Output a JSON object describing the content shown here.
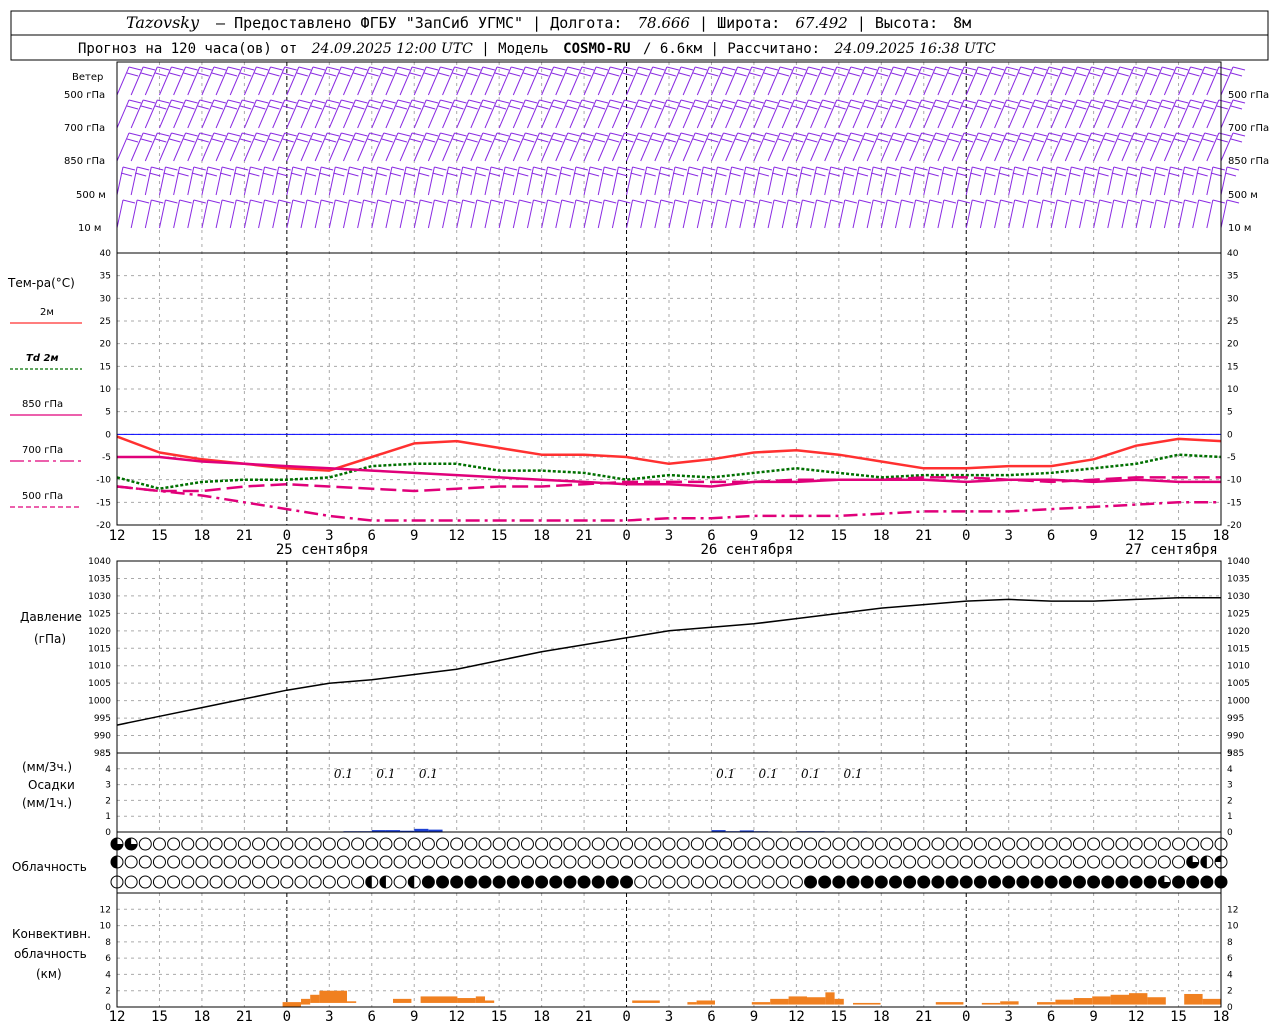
{
  "header": {
    "station": "Tazovsky",
    "provider": "– Предоставлено ФГБУ \"ЗапСиб УГМС\"",
    "lon_label": "Долгота:",
    "lon_value": "78.666",
    "lat_label": "Широта:",
    "lat_value": "67.492",
    "alt_label": "Высота:",
    "alt_value": "8м",
    "forecast_prefix": "Прогноз на 120 часа(ов) от",
    "forecast_time": "24.09.2025 12:00 UTC",
    "model_label": "Модель",
    "model_name": "COSMO-RU",
    "model_res": "/ 6.6км",
    "calc_label": "Рассчитано:",
    "calc_time": "24.09.2025 16:38 UTC"
  },
  "labels": {
    "wind_title": "Ветер",
    "wind_levels": [
      "500 гПа",
      "700 гПа",
      "850 гПа",
      "500 м",
      "10  м"
    ],
    "temp_title": "Тем-ра(°С)",
    "temp_legend": [
      "2м",
      "Td  2м",
      "850 гПа",
      "700 гПа",
      "500 гПа"
    ],
    "pressure_title": "Давление",
    "pressure_unit": "(гПа)",
    "precip_unit_3h": "(мм/3ч.)",
    "precip_title": "Осадки",
    "precip_unit_1h": "(мм/1ч.)",
    "cloud_title": "Облачность",
    "conv_title_1": "Конвективн.",
    "conv_title_2": "облачность",
    "conv_unit": "(км)",
    "day_labels": [
      "25 сентября",
      "26 сентября",
      "27 сентября"
    ],
    "hour_labels": [
      "12",
      "15",
      "18",
      "21",
      "0",
      "3",
      "6",
      "9",
      "12",
      "15",
      "18",
      "21",
      "0",
      "3",
      "6",
      "9",
      "12",
      "15",
      "18",
      "21",
      "0",
      "3",
      "6",
      "9",
      "12",
      "15",
      "18"
    ]
  },
  "colors": {
    "wind": "#8a2be2",
    "t2m": "#ff3030",
    "td2m": "#007000",
    "t850": "#e0007a",
    "t700": "#e0007a",
    "t500": "#e0007a",
    "pressure": "#000000",
    "precip": "#1c3fd4",
    "conv": "#f08020",
    "zero": "#0000ff",
    "grid": "#999999"
  },
  "chart_data": [
    {
      "type": "wind-barbs",
      "levels": [
        "500 гПа",
        "700 гПа",
        "850 гПа",
        "500 м",
        "10  м"
      ],
      "x_hours": [
        0,
        3,
        6,
        9,
        12,
        15,
        18,
        21,
        24,
        27,
        30,
        33,
        36,
        39,
        42,
        45,
        48,
        51,
        54,
        57,
        60,
        63,
        66,
        69,
        72,
        75,
        78
      ],
      "barbs_per_hour": 1
    },
    {
      "type": "line",
      "title": "Тем-ра(°С)",
      "x_hours": [
        0,
        3,
        6,
        9,
        12,
        15,
        18,
        21,
        24,
        27,
        30,
        33,
        36,
        39,
        42,
        45,
        48,
        51,
        54,
        57,
        60,
        63,
        66,
        69,
        72,
        75,
        78
      ],
      "ylim": [
        -20,
        40
      ],
      "yticks": [
        -20,
        -15,
        -10,
        -5,
        0,
        5,
        10,
        15,
        20,
        25,
        30,
        35,
        40
      ],
      "series": [
        {
          "name": "2м",
          "values": [
            -0.5,
            -4,
            -5.5,
            -6.5,
            -7.5,
            -8,
            -5,
            -2,
            -1.5,
            -3,
            -4.5,
            -4.5,
            -5,
            -6.5,
            -5.5,
            -4,
            -3.5,
            -4.5,
            -6,
            -7.5,
            -7.5,
            -7,
            -7,
            -5.5,
            -2.5,
            -1,
            -1.5
          ]
        },
        {
          "name": "Td  2м",
          "values": [
            -9.5,
            -12,
            -10.5,
            -10,
            -10,
            -9.5,
            -7,
            -6.5,
            -6.5,
            -8,
            -8,
            -8.5,
            -10,
            -9,
            -9.5,
            -8.5,
            -7.5,
            -8.5,
            -9.5,
            -9,
            -9,
            -9,
            -8.5,
            -7.5,
            -6.5,
            -4.5,
            -5
          ]
        },
        {
          "name": "850 гПа",
          "values": [
            -11.5,
            -12.5,
            -12.5,
            -11.5,
            -11,
            -11.5,
            -12,
            -12.5,
            -12,
            -11.5,
            -11.5,
            -11,
            -10.5,
            -10.5,
            -10.5,
            -10.5,
            -10,
            -10,
            -10,
            -9.5,
            -9.5,
            -10,
            -10.5,
            -10,
            -9.5,
            -9.5,
            -9.5
          ]
        },
        {
          "name": "700 гПа",
          "values": [
            -5,
            -5,
            -6,
            -6.5,
            -7,
            -7.5,
            -8,
            -8.5,
            -9,
            -9.5,
            -10,
            -10.5,
            -11,
            -11,
            -11.5,
            -10.5,
            -10.5,
            -10,
            -10,
            -10,
            -10.5,
            -10,
            -10,
            -10.5,
            -10,
            -10.5,
            -10.5
          ]
        },
        {
          "name": "500 гПа",
          "values": [
            -11.5,
            -12.5,
            -13.5,
            -15,
            -16.5,
            -18,
            -19,
            -19,
            -19,
            -19,
            -19,
            -19,
            -19,
            -18.5,
            -18.5,
            -18,
            -18,
            -18,
            -17.5,
            -17,
            -17,
            -17,
            -16.5,
            -16,
            -15.5,
            -15,
            -15
          ]
        }
      ]
    },
    {
      "type": "line",
      "title": "Давление",
      "ylabel": "(гПа)",
      "x_hours": [
        0,
        3,
        6,
        9,
        12,
        15,
        18,
        21,
        24,
        27,
        30,
        33,
        36,
        39,
        42,
        45,
        48,
        51,
        54,
        57,
        60,
        63,
        66,
        69,
        72,
        75,
        78
      ],
      "ylim": [
        985,
        1040
      ],
      "yticks": [
        985,
        990,
        995,
        1000,
        1005,
        1010,
        1015,
        1020,
        1025,
        1030,
        1035,
        1040
      ],
      "series": [
        {
          "name": "Давление",
          "values": [
            993,
            995.5,
            998,
            1000.5,
            1003,
            1005,
            1006,
            1007.5,
            1009,
            1011.5,
            1014,
            1016,
            1018,
            1020,
            1021,
            1022,
            1023.5,
            1025,
            1026.5,
            1027.5,
            1028.5,
            1029,
            1028.5,
            1028.5,
            1029,
            1029.5,
            1029.5
          ]
        }
      ]
    },
    {
      "type": "bar",
      "title": "Осадки",
      "ylim": [
        0,
        5
      ],
      "yticks": [
        0,
        1,
        2,
        3,
        4,
        5
      ],
      "annotations": [
        {
          "hour": 16,
          "text": "0.1"
        },
        {
          "hour": 19,
          "text": "0.1"
        },
        {
          "hour": 22,
          "text": "0.1"
        },
        {
          "hour": 43,
          "text": "0.1"
        },
        {
          "hour": 46,
          "text": "0.1"
        },
        {
          "hour": 49,
          "text": "0.1"
        },
        {
          "hour": 52,
          "text": "0.1"
        }
      ],
      "hourly": [
        {
          "hour": 15,
          "value": 0.02
        },
        {
          "hour": 16,
          "value": 0.05
        },
        {
          "hour": 17,
          "value": 0.05
        },
        {
          "hour": 18,
          "value": 0.12
        },
        {
          "hour": 19,
          "value": 0.12
        },
        {
          "hour": 20,
          "value": 0.08
        },
        {
          "hour": 21,
          "value": 0.2
        },
        {
          "hour": 22,
          "value": 0.15
        },
        {
          "hour": 42,
          "value": 0.12
        },
        {
          "hour": 43,
          "value": 0.05
        },
        {
          "hour": 44,
          "value": 0.1
        },
        {
          "hour": 45,
          "value": 0.05
        },
        {
          "hour": 46,
          "value": 0.04
        },
        {
          "hour": 48,
          "value": 0.05
        },
        {
          "hour": 49,
          "value": 0.05
        },
        {
          "hour": 50,
          "value": 0.04
        },
        {
          "hour": 51,
          "value": 0.03
        },
        {
          "hour": 52,
          "value": 0.04
        },
        {
          "hour": 53,
          "value": 0.03
        },
        {
          "hour": 75,
          "value": 0.03
        }
      ]
    },
    {
      "type": "table",
      "title": "Облачность",
      "rows": 3,
      "hours_per_col": 1,
      "cover": {
        "top": "TT00000000000000000000000000000000000000000000000000000000000000000000000000000000",
        "mid": "H000000000000000000000000000000000000000000000000000000000000000000000000000THQH",
        "low": "000000000000000000HH0H1111111111111110000000000001111111111111111111111111T1111"
      }
    },
    {
      "type": "bar",
      "title": "Конвективн. облачность",
      "ylabel": "(км)",
      "ylim": [
        0,
        14
      ],
      "yticks": [
        0,
        2,
        4,
        6,
        8,
        10,
        12
      ],
      "segments": [
        {
          "from": 18,
          "to": 20,
          "bottom": 0,
          "top": 0.6
        },
        {
          "from": 20,
          "to": 21,
          "bottom": 0.3,
          "top": 1.0
        },
        {
          "from": 21,
          "to": 22,
          "bottom": 0.5,
          "top": 1.5
        },
        {
          "from": 22,
          "to": 25,
          "bottom": 0.5,
          "top": 2.0
        },
        {
          "from": 25,
          "to": 26,
          "bottom": 0.5,
          "top": 0.7
        },
        {
          "from": 30,
          "to": 32,
          "bottom": 0.5,
          "top": 1.0
        },
        {
          "from": 33,
          "to": 37,
          "bottom": 0.5,
          "top": 1.3
        },
        {
          "from": 37,
          "to": 39,
          "bottom": 0.5,
          "top": 1.1
        },
        {
          "from": 39,
          "to": 40,
          "bottom": 0.5,
          "top": 1.3
        },
        {
          "from": 40,
          "to": 41,
          "bottom": 0.5,
          "top": 0.8
        },
        {
          "from": 56,
          "to": 59,
          "bottom": 0.5,
          "top": 0.8
        },
        {
          "from": 62,
          "to": 63,
          "bottom": 0.3,
          "top": 0.6
        },
        {
          "from": 63,
          "to": 65,
          "bottom": 0.3,
          "top": 0.8
        },
        {
          "from": 69,
          "to": 71,
          "bottom": 0.3,
          "top": 0.6
        },
        {
          "from": 71,
          "to": 73,
          "bottom": 0.3,
          "top": 1.0
        },
        {
          "from": 73,
          "to": 75,
          "bottom": 0.3,
          "top": 1.3
        },
        {
          "from": 75,
          "to": 77,
          "bottom": 0.3,
          "top": 1.2
        },
        {
          "from": 77,
          "to": 78,
          "bottom": 0.3,
          "top": 1.8
        },
        {
          "from": 78,
          "to": 79,
          "bottom": 0.3,
          "top": 1.0
        },
        {
          "from": 80,
          "to": 83,
          "bottom": 0.3,
          "top": 0.5
        },
        {
          "from": 89,
          "to": 92,
          "bottom": 0.3,
          "top": 0.6
        },
        {
          "from": 94,
          "to": 96,
          "bottom": 0.3,
          "top": 0.5
        },
        {
          "from": 96,
          "to": 98,
          "bottom": 0.3,
          "top": 0.7
        },
        {
          "from": 100,
          "to": 102,
          "bottom": 0.3,
          "top": 0.6
        },
        {
          "from": 102,
          "to": 104,
          "bottom": 0.3,
          "top": 0.9
        },
        {
          "from": 104,
          "to": 106,
          "bottom": 0.3,
          "top": 1.1
        },
        {
          "from": 106,
          "to": 108,
          "bottom": 0.3,
          "top": 1.3
        },
        {
          "from": 108,
          "to": 110,
          "bottom": 0.3,
          "top": 1.5
        },
        {
          "from": 110,
          "to": 112,
          "bottom": 0.3,
          "top": 1.7
        },
        {
          "from": 112,
          "to": 114,
          "bottom": 0.3,
          "top": 1.2
        },
        {
          "from": 116,
          "to": 118,
          "bottom": 0.3,
          "top": 1.6
        },
        {
          "from": 118,
          "to": 120,
          "bottom": 0.3,
          "top": 1.0
        }
      ]
    }
  ]
}
